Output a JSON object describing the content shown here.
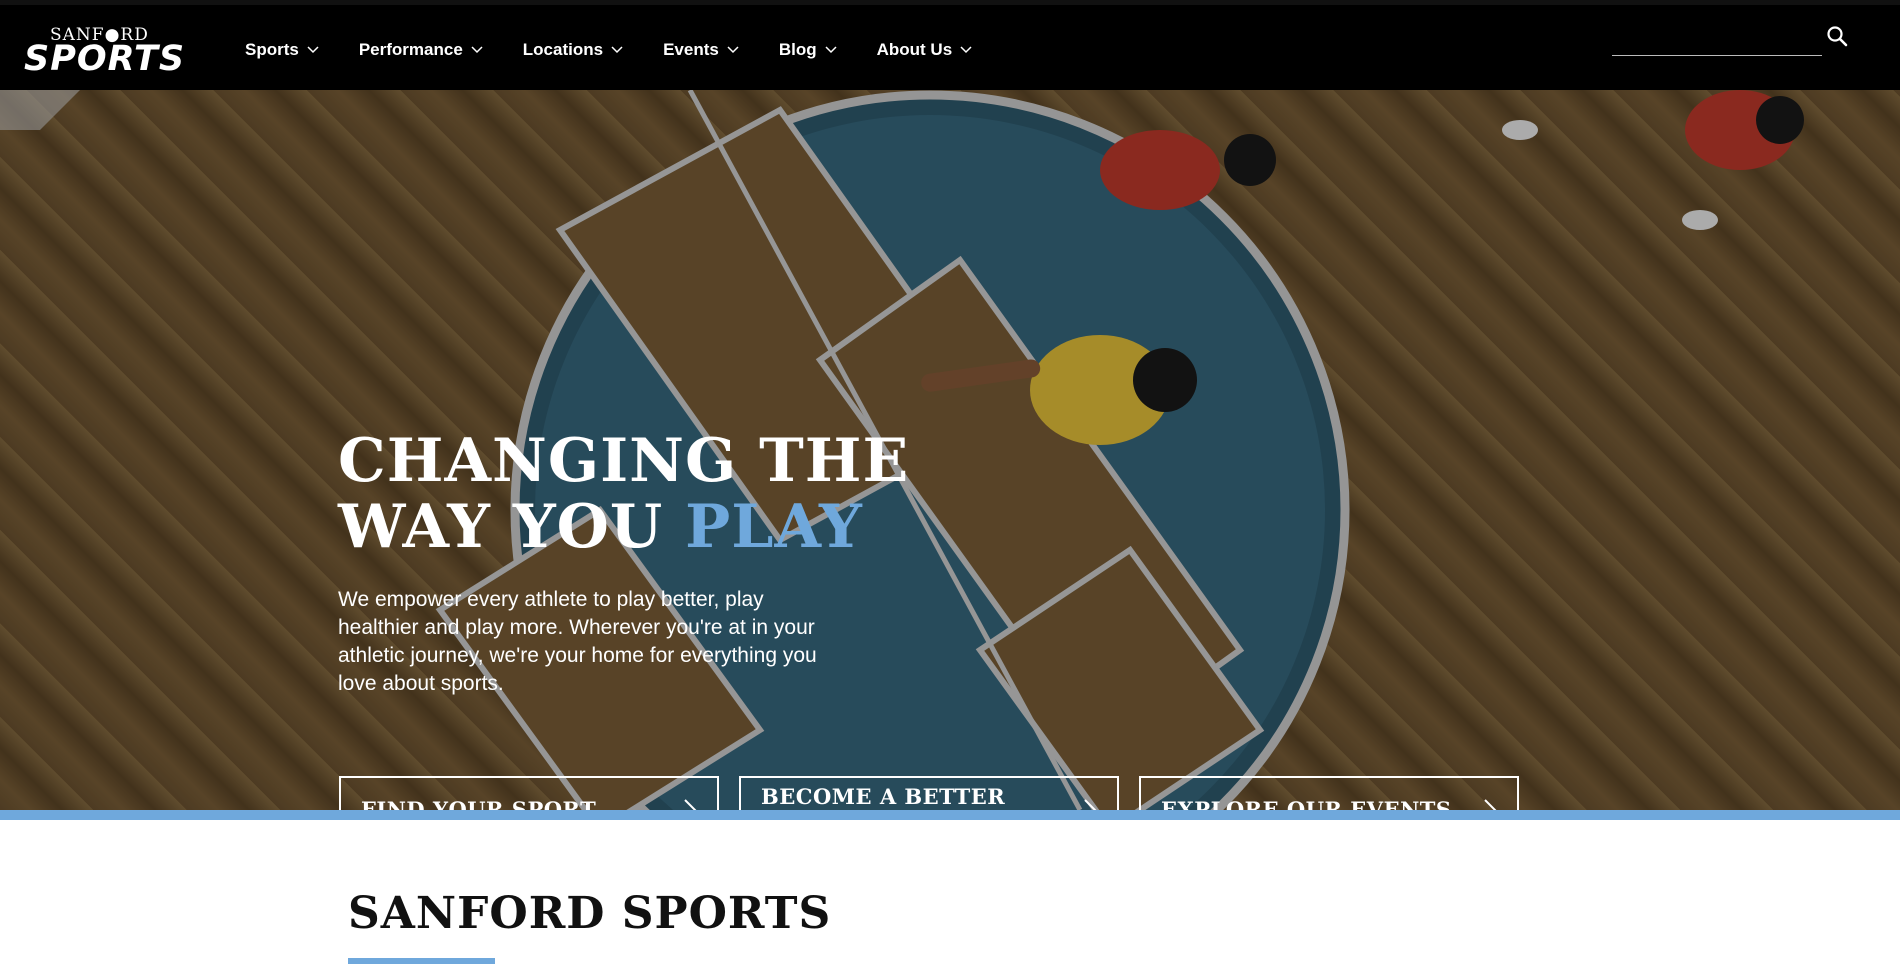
{
  "brand": {
    "logo_top": "SANF●RD",
    "logo_main": "SPORTS"
  },
  "nav": {
    "items": [
      {
        "label": "Sports"
      },
      {
        "label": "Performance"
      },
      {
        "label": "Locations"
      },
      {
        "label": "Events"
      },
      {
        "label": "Blog"
      },
      {
        "label": "About Us"
      }
    ]
  },
  "search": {
    "icon": "search-icon"
  },
  "hero": {
    "headline_line1": "CHANGING THE",
    "headline_line2_prefix": "WAY YOU ",
    "headline_line2_accent": "PLAY",
    "subtext": "We empower every athlete to play better, play healthier and play more. Wherever you're at in your athletic journey, we're your home for everything you love about sports.",
    "ctas": [
      {
        "label": "FIND YOUR SPORT"
      },
      {
        "label": "BECOME A BETTER ATHLETE"
      },
      {
        "label": "EXPLORE OUR EVENTS"
      }
    ]
  },
  "section": {
    "title": "SANFORD SPORTS"
  },
  "colors": {
    "accent": "#6fa8dc",
    "topbar": "#000000",
    "text": "#111111"
  }
}
